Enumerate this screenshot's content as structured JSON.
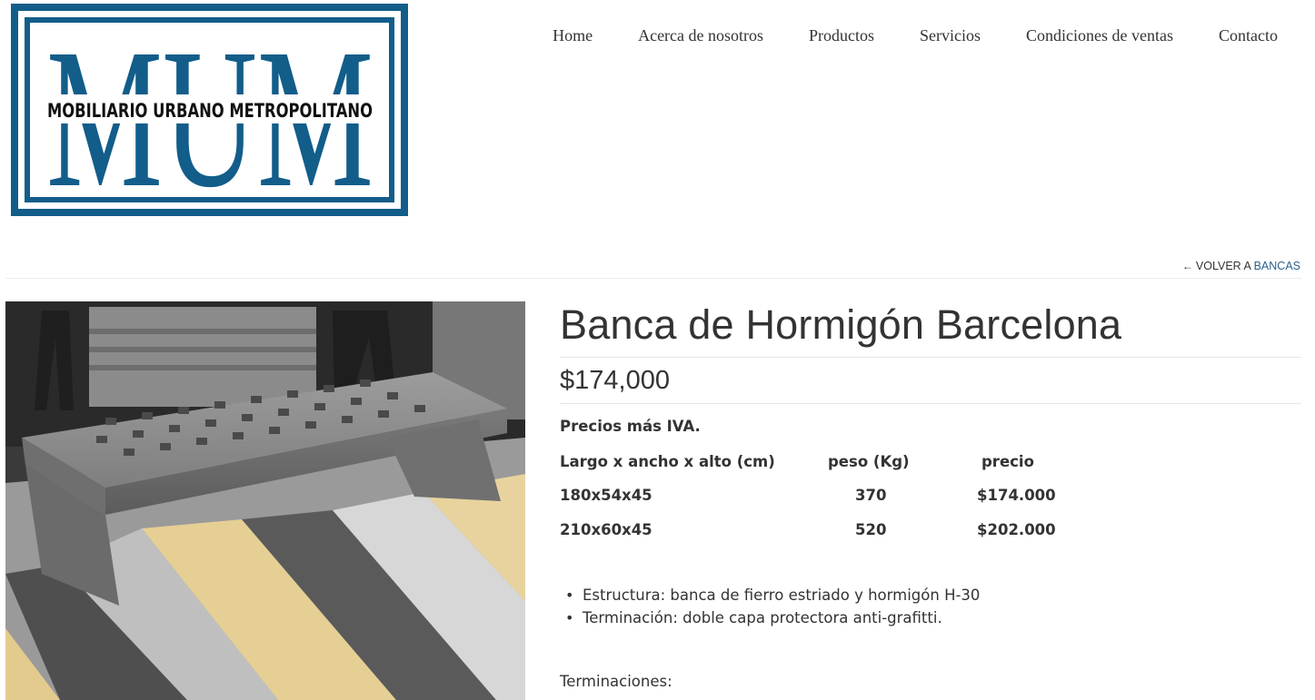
{
  "brand": {
    "logo_letters": "MUM",
    "logo_tagline": "MOBILIARIO URBANO METROPOLITANO",
    "color": "#125d8a"
  },
  "nav": {
    "items": [
      {
        "label": "Home"
      },
      {
        "label": "Acerca de nosotros"
      },
      {
        "label": "Productos"
      },
      {
        "label": "Servicios"
      },
      {
        "label": "Condiciones de ventas"
      },
      {
        "label": "Contacto"
      }
    ]
  },
  "back_link": {
    "arrow_icon": "arrow-left-icon",
    "prefix": "VOLVER A",
    "crumb": "BANCAS"
  },
  "product": {
    "image_alt": "bench-photo",
    "title": "Banca de Hormigón Barcelona",
    "price": "$174,000",
    "note": "Precios más IVA.",
    "table": {
      "headers": [
        "Largo x ancho x alto (cm)",
        "peso (Kg)",
        "precio"
      ],
      "rows": [
        [
          "180x54x45",
          "370",
          "$174.000"
        ],
        [
          "210x60x45",
          "520",
          "$202.000"
        ]
      ]
    },
    "features": [
      "Estructura: banca de fierro estriado y hormigón H-30",
      "Terminación: doble capa protectora anti-grafitti."
    ],
    "finishes_label": "Terminaciones:"
  }
}
